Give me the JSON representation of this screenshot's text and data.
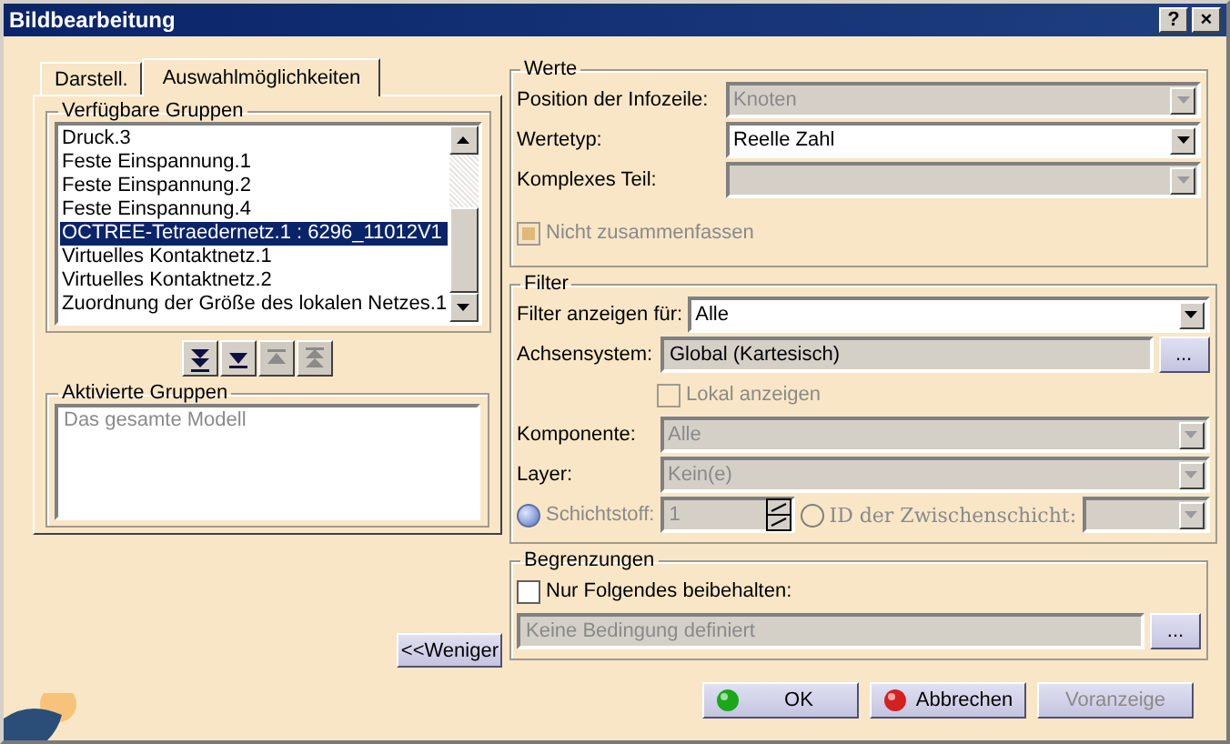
{
  "window": {
    "title": "Bildbearbeitung",
    "help_button": "?",
    "close_button": "×"
  },
  "tabs": [
    {
      "label": "Darstell.",
      "selected": false
    },
    {
      "label": "Auswahlmöglichkeiten",
      "selected": true
    }
  ],
  "available_groups": {
    "title": "Verfügbare Gruppen",
    "items": [
      {
        "label": "Druck.3",
        "selected": false
      },
      {
        "label": "Feste Einspannung.1",
        "selected": false
      },
      {
        "label": "Feste Einspannung.2",
        "selected": false
      },
      {
        "label": "Feste Einspannung.4",
        "selected": false
      },
      {
        "label": "OCTREE-Tetraedernetz.1 : 6296_11012V1",
        "selected": true
      },
      {
        "label": "Virtuelles Kontaktnetz.1",
        "selected": false
      },
      {
        "label": "Virtuelles Kontaktnetz.2",
        "selected": false
      },
      {
        "label": "Zuordnung der Größe des lokalen Netzes.1",
        "selected": false
      }
    ]
  },
  "move_buttons": [
    {
      "kind": "all-down",
      "disabled": false
    },
    {
      "kind": "down",
      "disabled": false
    },
    {
      "kind": "up",
      "disabled": true
    },
    {
      "kind": "all-up",
      "disabled": true
    }
  ],
  "activated_groups": {
    "title": "Aktivierte Gruppen",
    "items": [
      {
        "label": "Das gesamte Modell",
        "disabled": true
      }
    ]
  },
  "less_button": "<<Weniger",
  "values": {
    "title": "Werte",
    "fields": [
      {
        "label": "Position der Infozeile:",
        "value": "Knoten",
        "disabled": true
      },
      {
        "label": "Wertetyp:",
        "value": "Reelle Zahl",
        "disabled": false
      },
      {
        "label": "Komplexes Teil:",
        "disabled": true
      }
    ],
    "checkbox": {
      "label": "Nicht zusammenfassen",
      "checked": true,
      "disabled": true
    }
  },
  "filter": {
    "title": "Filter",
    "rows": [
      {
        "kind": "dropdown",
        "label": "Filter anzeigen für:",
        "value": "Alle",
        "disabled": false
      },
      {
        "kind": "browse",
        "label": "Achsensystem:",
        "value": "Global (Kartesisch)",
        "button": "..."
      },
      {
        "kind": "checkbox",
        "label": "Lokal anzeigen",
        "checked": false,
        "disabled": true
      },
      {
        "kind": "dropdown",
        "label": "Komponente:",
        "value": "Alle",
        "disabled": true
      },
      {
        "kind": "dropdown",
        "label": "Layer:",
        "value": "Kein(e)",
        "disabled": true
      },
      {
        "kind": "layer-choice",
        "radio_1": {
          "label": "Schichtstoff:",
          "selected": true,
          "disabled": true
        },
        "spinner": {
          "value": "1",
          "disabled": true
        },
        "radio_2": {
          "label": "ID der Zwischenschicht:",
          "selected": false,
          "disabled": true
        },
        "dropdown": {
          "disabled": true
        }
      }
    ]
  },
  "limits": {
    "title": "Begrenzungen",
    "checkbox": {
      "label": "Nur Folgendes beibehalten:",
      "checked": false,
      "disabled": false
    },
    "field": {
      "value": "Keine Bedingung definiert",
      "disabled": true,
      "button": "..."
    }
  },
  "buttons": [
    {
      "kind": "ok",
      "label": "OK",
      "disabled": false
    },
    {
      "kind": "cancel",
      "label": "Abbrechen",
      "disabled": false
    },
    {
      "kind": "preview",
      "label": "Voranzeige",
      "disabled": true
    }
  ]
}
